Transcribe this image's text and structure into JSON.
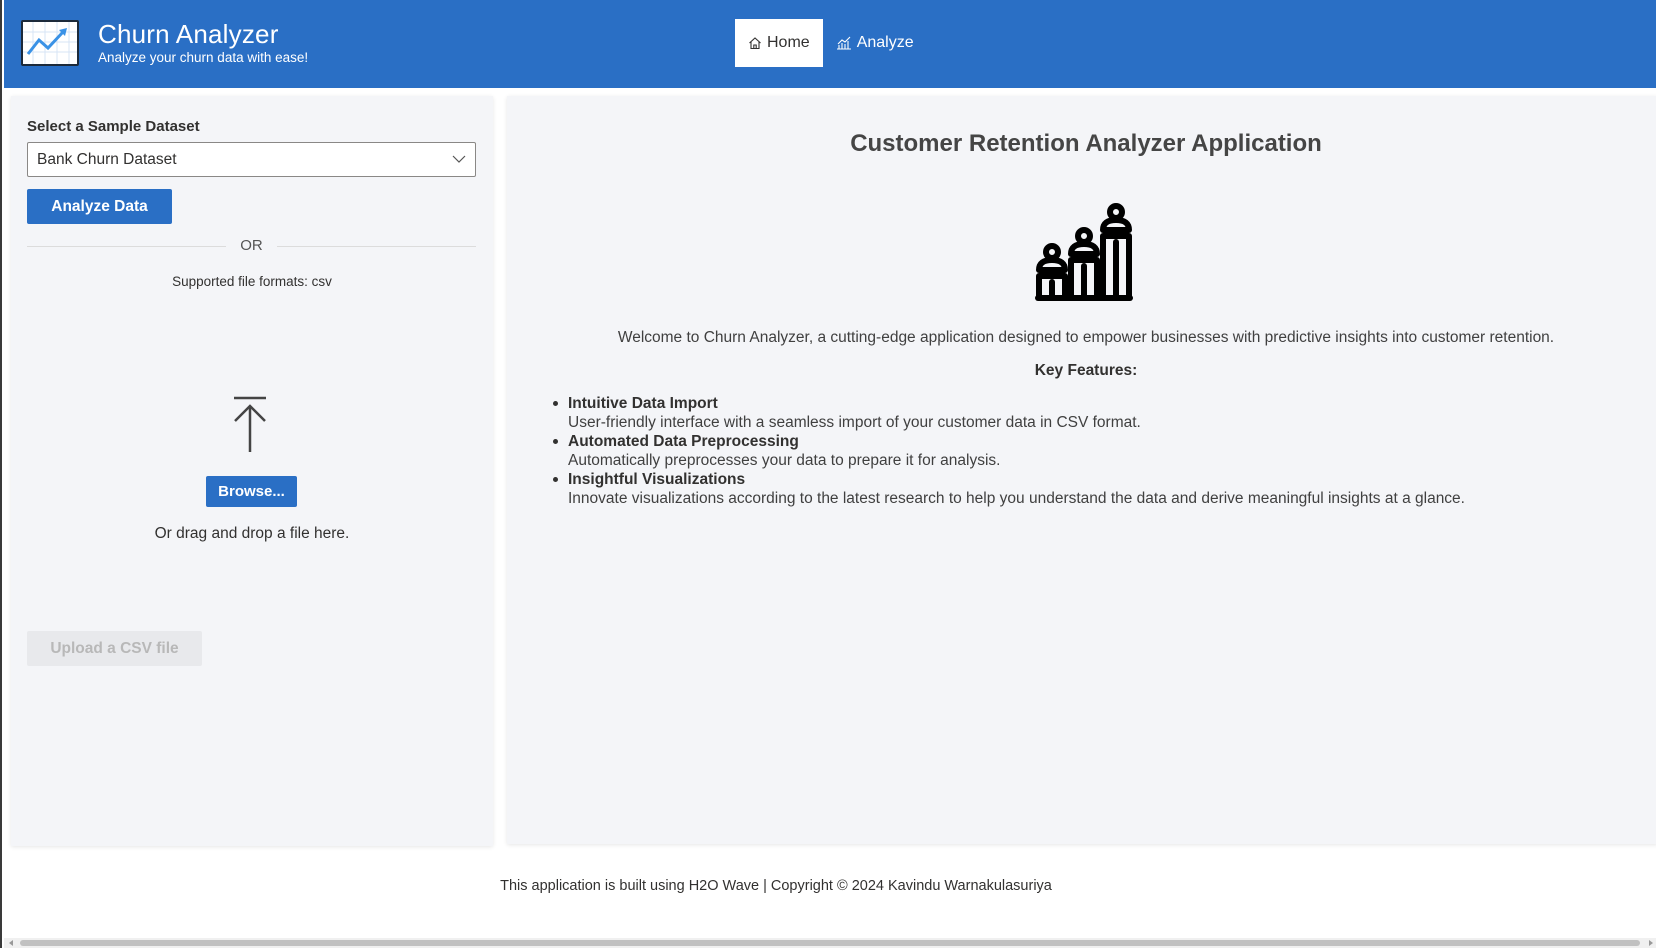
{
  "header": {
    "title": "Churn Analyzer",
    "subtitle": "Analyze your churn data with ease!",
    "logo_icon": "line-chart-icon",
    "background": "#2a6fc5"
  },
  "nav": {
    "items": [
      {
        "label": "Home",
        "icon": "home-icon",
        "active": true
      },
      {
        "label": "Analyze",
        "icon": "chart-icon",
        "active": false
      }
    ]
  },
  "sidebar": {
    "select_label": "Select a Sample Dataset",
    "select_value": "Bank Churn Dataset",
    "analyze_button": "Analyze Data",
    "or_text": "OR",
    "formats_text": "Supported file formats: csv",
    "upload_icon": "upload-arrow-icon",
    "browse_button": "Browse...",
    "drag_text": "Or drag and drop a file here.",
    "upload_button": "Upload a CSV file"
  },
  "main": {
    "title": "Customer Retention Analyzer Application",
    "hero_icon": "people-growth-chart-icon",
    "welcome": "Welcome to Churn Analyzer, a cutting-edge application designed to empower businesses with predictive insights into customer retention.",
    "key_features_title": "Key Features:",
    "features": [
      {
        "title": "Intuitive Data Import",
        "desc": "User-friendly interface with a seamless import of your customer data in CSV format."
      },
      {
        "title": "Automated Data Preprocessing",
        "desc": "Automatically preprocesses your data to prepare it for analysis."
      },
      {
        "title": "Insightful Visualizations",
        "desc": "Innovate visualizations according to the latest research to help you understand the data and derive meaningful insights at a glance."
      }
    ]
  },
  "footer": {
    "text": "This application is built using H2O Wave | Copyright © 2024 Kavindu Warnakulasuriya"
  }
}
